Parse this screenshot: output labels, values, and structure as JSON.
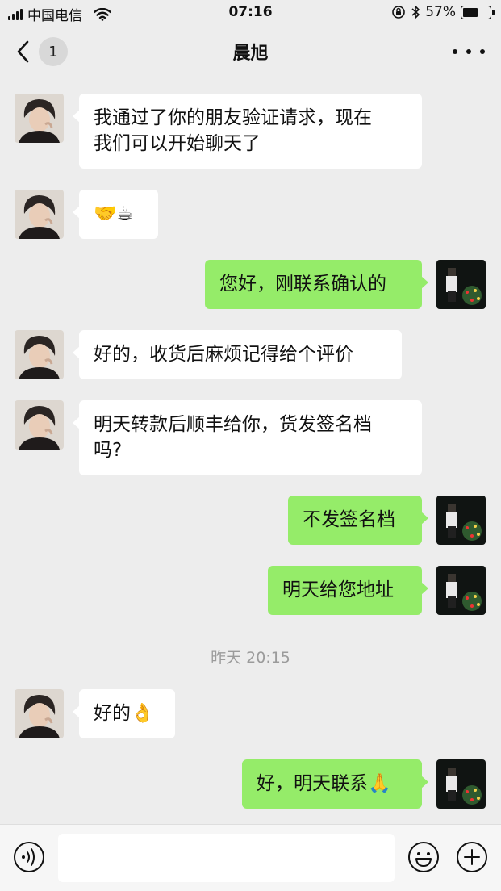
{
  "status_bar": {
    "carrier": "中国电信",
    "time": "07:16",
    "battery_percent": "57%",
    "battery_level": 0.57
  },
  "nav": {
    "unread_count": "1",
    "title": "晨旭",
    "back_icon": "chevron-left-icon",
    "more_icon": "more-dots-icon"
  },
  "messages": [
    {
      "from": "friend",
      "text": "我通过了你的朋友验证请求，现在\n我们可以开始聊天了"
    },
    {
      "from": "friend",
      "text": "🤝☕"
    },
    {
      "from": "me",
      "text": "您好，刚联系确认的"
    },
    {
      "from": "friend",
      "text": "好的，收货后麻烦记得给个评价"
    },
    {
      "from": "friend",
      "text": "明天转款后顺丰给你，货发签名档\n吗?"
    },
    {
      "from": "me",
      "text": "不发签名档"
    },
    {
      "from": "me",
      "text": "明天给您地址"
    },
    {
      "from": "friend",
      "text": "好的👌"
    },
    {
      "from": "me",
      "text": "好，明天联系🙏"
    }
  ],
  "timestamp": "昨天 20:15",
  "input_bar": {
    "voice_icon": "voice-icon",
    "emoji_icon": "emoji-icon",
    "plus_icon": "plus-icon",
    "placeholder": ""
  },
  "colors": {
    "background": "#ededed",
    "bubble_me": "#95ec69",
    "bubble_friend": "#ffffff"
  }
}
